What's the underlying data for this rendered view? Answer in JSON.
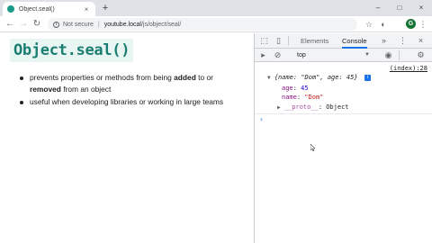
{
  "tab": {
    "title": "Object.seal()",
    "close": "×",
    "new": "+"
  },
  "window": {
    "minimize": "–",
    "maximize": "□",
    "close": "×"
  },
  "toolbar": {
    "back": "←",
    "forward": "→",
    "reload": "↻",
    "not_secure": "Not secure",
    "separator": "|",
    "url_host": "youtube.local",
    "url_path": "/js/object/seal/",
    "profile_initial": "G"
  },
  "page": {
    "title": "Object.seal()",
    "bullets": [
      {
        "before": "prevents properties or methods from being ",
        "bold1": "added",
        "middle": " to or",
        "bold2": "removed",
        "after": " from an object"
      },
      {
        "text": "useful when developing libraries or working in large teams"
      }
    ]
  },
  "devtools": {
    "tabs": [
      "Elements",
      "Console"
    ],
    "more": "»",
    "context": "top",
    "source_link": "(index):28",
    "object_summary": "{name: \"Dom\", age: 45}",
    "props": [
      {
        "key": "age",
        "value": "45"
      },
      {
        "key": "name",
        "value": "\"Dom\""
      }
    ],
    "proto_key": "__proto__",
    "proto_value": "Object",
    "info_badge": "i",
    "prompt": "›"
  },
  "colors": {
    "accent": "#1a7f72",
    "title_bg": "#e9f5f2",
    "devtools_active": "#1a73e8"
  }
}
